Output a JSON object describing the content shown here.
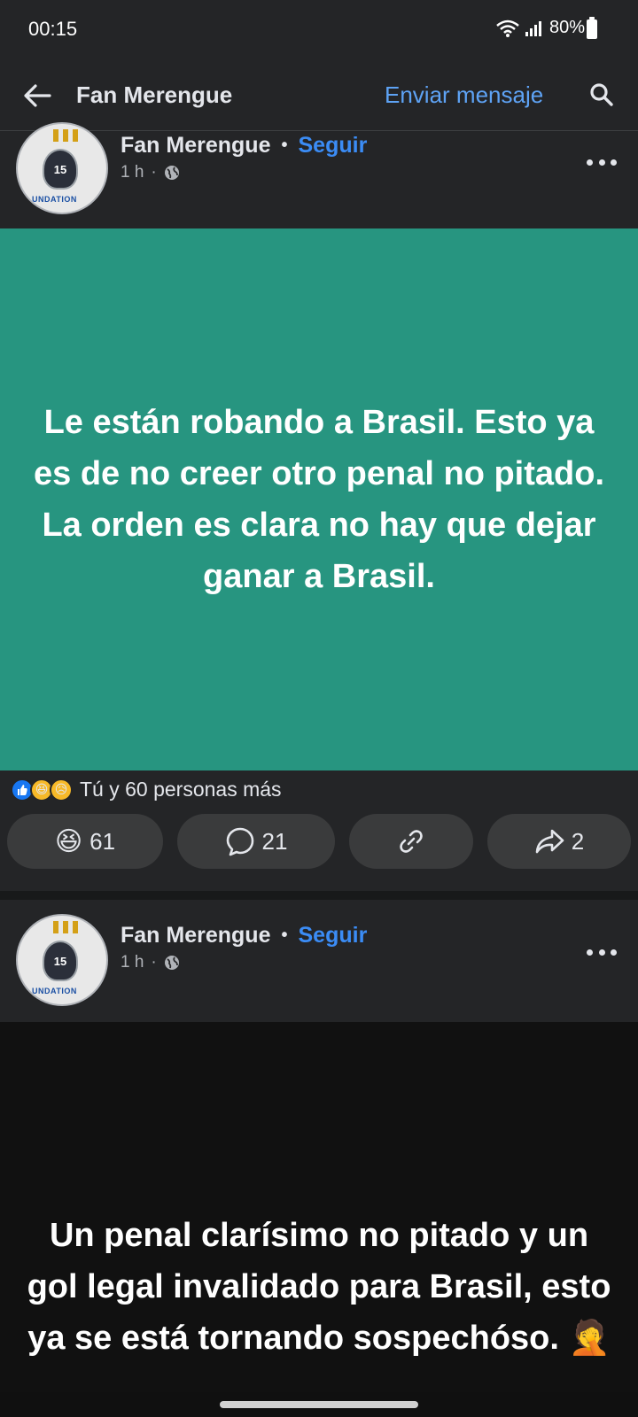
{
  "status": {
    "time": "00:15",
    "battery": "80%"
  },
  "header": {
    "title": "Fan Merengue",
    "send_message": "Enviar mensaje"
  },
  "posts": [
    {
      "author": "Fan Merengue",
      "follow": "Seguir",
      "time": "1 h",
      "avatar_number": "15",
      "avatar_caption": "UNDATION",
      "text": "Le están robando a Brasil. Esto ya es de no creer otro penal no pitado. La orden es clara no hay que dejar ganar a Brasil.",
      "background": "#279580",
      "reactions_summary": "Tú y 60 personas más",
      "reaction_count": "61",
      "comment_count": "21",
      "share_count": "2"
    },
    {
      "author": "Fan Merengue",
      "follow": "Seguir",
      "time": "1 h",
      "avatar_number": "15",
      "avatar_caption": "UNDATION",
      "text": "Un penal clarísimo no pitado y un gol legal invalidado para Brasil, esto ya se está tornando sospechóso. 🤦",
      "background": "#111111"
    }
  ],
  "colors": {
    "accent": "#3b8cf5",
    "pill": "#3a3b3c",
    "surface": "#242527"
  },
  "icons": {
    "back": "arrow-left-icon",
    "search": "search-icon",
    "more": "more-horizontal-icon",
    "globe": "globe-icon",
    "comment": "comment-icon",
    "link": "link-icon",
    "share": "share-icon"
  }
}
